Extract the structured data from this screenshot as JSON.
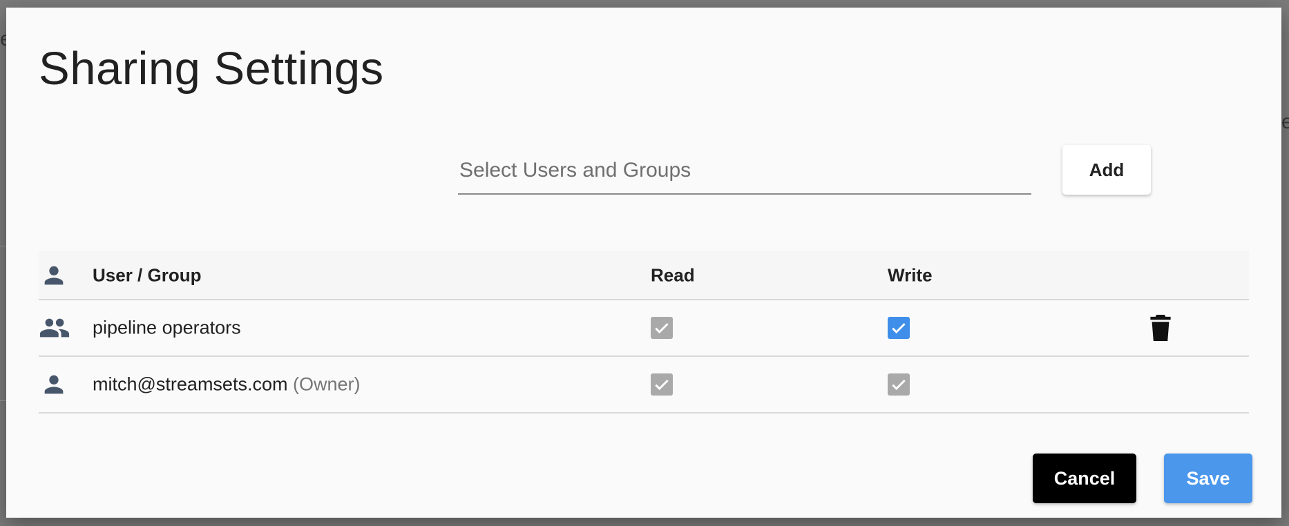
{
  "dialog": {
    "title": "Sharing Settings"
  },
  "search": {
    "placeholder": "Select Users and Groups",
    "value": ""
  },
  "add_button": {
    "label": "Add"
  },
  "table": {
    "headers": {
      "icon": "person-icon",
      "user_group": "User / Group",
      "read": "Read",
      "write": "Write"
    },
    "rows": [
      {
        "icon": "group-icon",
        "name": "pipeline operators",
        "owner_tag": "",
        "read": true,
        "read_editable": false,
        "write": true,
        "write_editable": true,
        "deletable": true
      },
      {
        "icon": "person-icon",
        "name": "mitch@streamsets.com",
        "owner_tag": "(Owner)",
        "read": true,
        "read_editable": false,
        "write": true,
        "write_editable": false,
        "deletable": false
      }
    ]
  },
  "footer": {
    "cancel_label": "Cancel",
    "save_label": "Save"
  },
  "colors": {
    "accent": "#4a97ec",
    "checkbox_active": "#3f8ee9",
    "checkbox_disabled": "#a9a9a9",
    "icon": "#47566b"
  }
}
